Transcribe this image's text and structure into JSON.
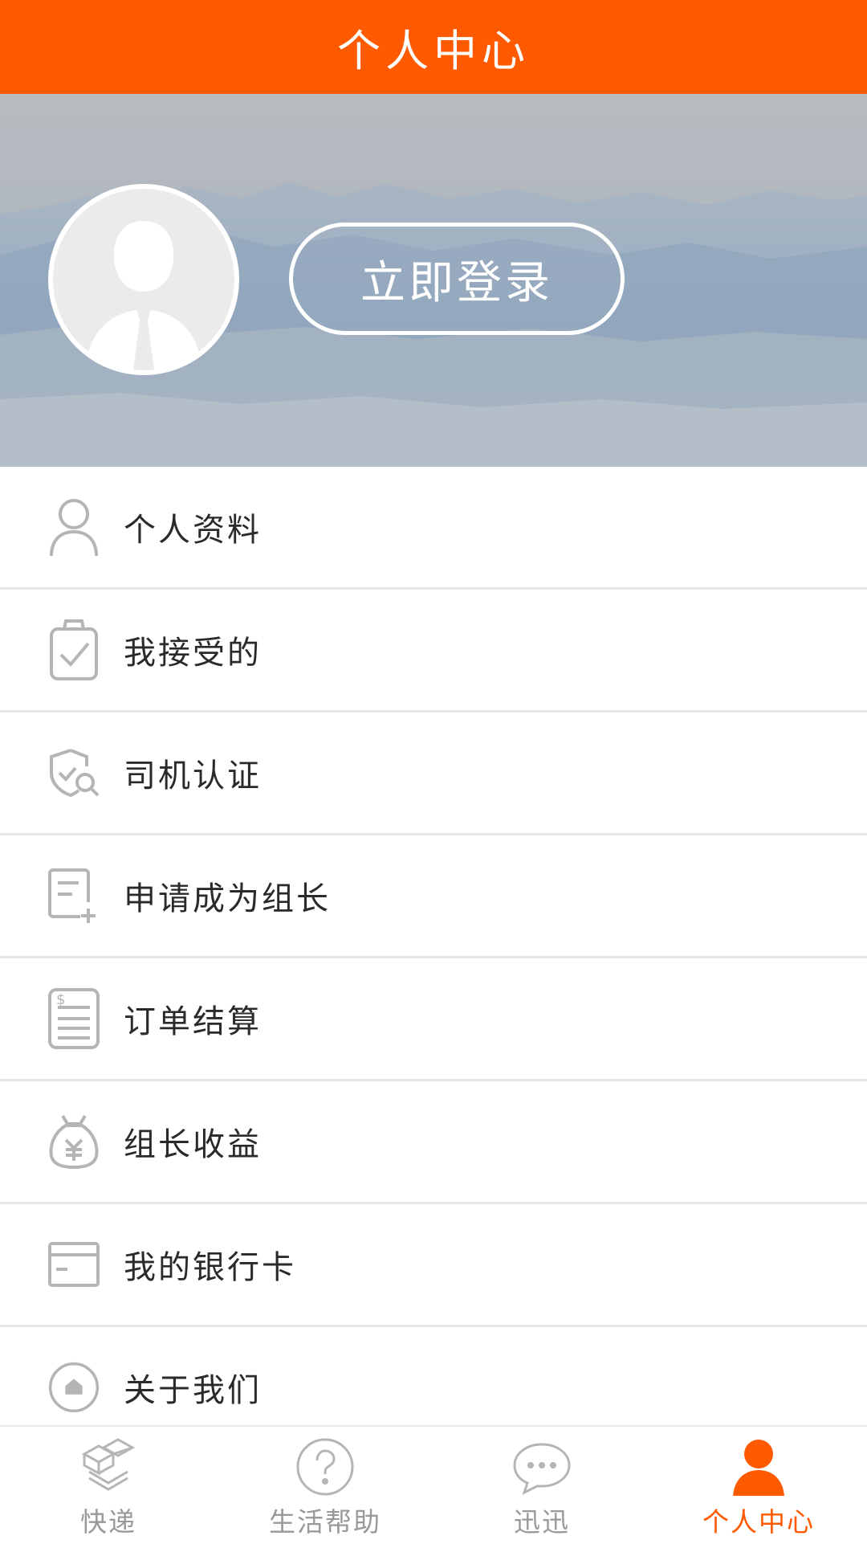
{
  "header": {
    "title": "个人中心"
  },
  "profile": {
    "login_label": "立即登录"
  },
  "menu": [
    {
      "label": "个人资料",
      "icon": "person-icon"
    },
    {
      "label": "我接受的",
      "icon": "clipboard-check-icon"
    },
    {
      "label": "司机认证",
      "icon": "shield-search-icon"
    },
    {
      "label": "申请成为组长",
      "icon": "document-add-icon"
    },
    {
      "label": "订单结算",
      "icon": "receipt-icon"
    },
    {
      "label": "组长收益",
      "icon": "money-bag-icon"
    },
    {
      "label": "我的银行卡",
      "icon": "card-icon"
    },
    {
      "label": "关于我们",
      "icon": "home-circle-icon"
    }
  ],
  "bottom_nav": [
    {
      "label": "快递",
      "icon": "boxes-icon",
      "active": false
    },
    {
      "label": "生活帮助",
      "icon": "question-icon",
      "active": false
    },
    {
      "label": "迅迅",
      "icon": "chat-icon",
      "active": false
    },
    {
      "label": "个人中心",
      "icon": "person-filled-icon",
      "active": true
    }
  ],
  "colors": {
    "accent": "#ff5a00",
    "icon_gray": "#b5b5b5",
    "text": "#2a2a2a",
    "muted": "#999999"
  }
}
